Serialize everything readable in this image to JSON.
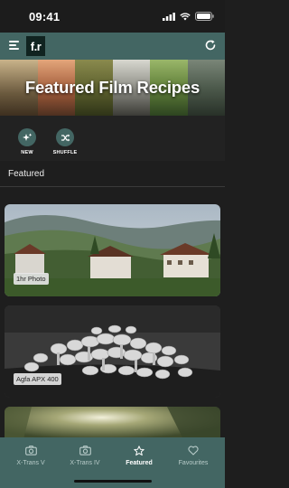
{
  "status_bar": {
    "time": "09:41"
  },
  "nav_bar": {
    "logo_text": "f.r"
  },
  "banner": {
    "title": "Featured Film Recipes"
  },
  "quick_actions": [
    {
      "label": "NEW",
      "icon": "sparkle-icon"
    },
    {
      "label": "SHUFFLE",
      "icon": "shuffle-icon"
    }
  ],
  "section": {
    "title": "Featured"
  },
  "cards": [
    {
      "label": "1hr Photo"
    },
    {
      "label": "Agfa APX 400"
    },
    {
      "label": ""
    }
  ],
  "tabs": [
    {
      "label": "X-Trans V",
      "icon": "camera-icon",
      "active": false
    },
    {
      "label": "X-Trans IV",
      "icon": "camera-icon",
      "active": false
    },
    {
      "label": "Featured",
      "icon": "star-icon",
      "active": true
    },
    {
      "label": "Favourites",
      "icon": "heart-icon",
      "active": false
    }
  ],
  "colors": {
    "accent": "#436663",
    "background": "#1e1e1e"
  }
}
